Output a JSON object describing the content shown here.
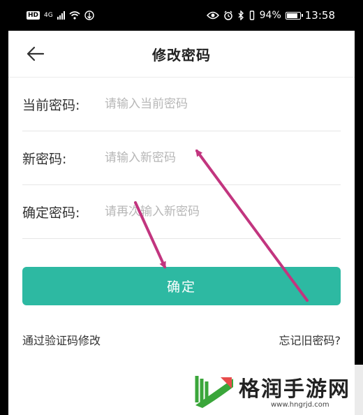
{
  "status_bar": {
    "hd": "HD",
    "network": "4G",
    "battery_percent": "94%",
    "time": "13:58",
    "battery_level": 0.94
  },
  "header": {
    "title": "修改密码",
    "back_icon": "back-arrow-icon"
  },
  "form": {
    "current_label": "当前密码:",
    "current_placeholder": "请输入当前密码",
    "new_label": "新密码:",
    "new_placeholder": "请输入新密码",
    "confirm_label": "确定密码:",
    "confirm_placeholder": "请再次输入新密码"
  },
  "actions": {
    "confirm_label": "确定",
    "verify_link": "通过验证码修改",
    "forgot_link": "忘记旧密码?"
  },
  "colors": {
    "accent": "#2db9a2",
    "annotation_arrow": "#c2357f"
  },
  "watermark": {
    "text": "格润手游网",
    "url": "www.hngrjd.com"
  }
}
